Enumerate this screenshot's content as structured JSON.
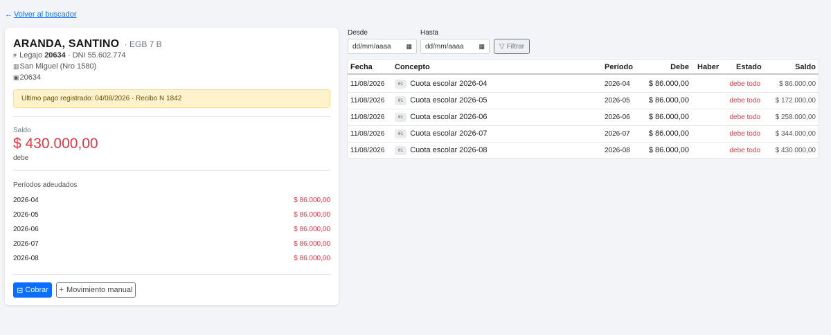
{
  "nav": {
    "back_label": "Volver al buscador"
  },
  "student": {
    "name": "ARANDA, SANTINO",
    "course": "· EGB 7 B",
    "legajo_label": "Legajo",
    "legajo": "20634",
    "dni": "· DNI 55.602.774",
    "address": "San Miguel (Nro 1580)",
    "id_code": "20634"
  },
  "alert": {
    "text": "Ultimo pago registrado: 04/08/2026 · Recibo N 1842"
  },
  "balance": {
    "label": "Saldo",
    "value": "$ 430.000,00",
    "status": "debe"
  },
  "periods": {
    "title": "Períodos adeudados",
    "items": [
      {
        "period": "2026-04",
        "amount": "$ 86.000,00"
      },
      {
        "period": "2026-05",
        "amount": "$ 86.000,00"
      },
      {
        "period": "2026-06",
        "amount": "$ 86.000,00"
      },
      {
        "period": "2026-07",
        "amount": "$ 86.000,00"
      },
      {
        "period": "2026-08",
        "amount": "$ 86.000,00"
      }
    ]
  },
  "actions": {
    "cobrar_label": "Cobrar",
    "manual_label": "Movimiento manual"
  },
  "filters": {
    "desde_label": "Desde",
    "hasta_label": "Hasta",
    "desde_placeholder": "dd/mm/aaaa",
    "hasta_placeholder": "dd/mm/aaaa",
    "filter_label": "Filtrar"
  },
  "table": {
    "headers": {
      "fecha": "Fecha",
      "concepto": "Concepto",
      "periodo": "Período",
      "debe": "Debe",
      "haber": "Haber",
      "estado": "Estado",
      "saldo": "Saldo"
    },
    "rows": [
      {
        "fecha": "11/08/2026",
        "code": "01",
        "concepto": "Cuota escolar 2026-04",
        "periodo": "2026-04",
        "debe": "$ 86.000,00",
        "haber": "",
        "estado": "debe todo",
        "saldo": "$ 86.000,00"
      },
      {
        "fecha": "11/08/2026",
        "code": "01",
        "concepto": "Cuota escolar 2026-05",
        "periodo": "2026-05",
        "debe": "$ 86.000,00",
        "haber": "",
        "estado": "debe todo",
        "saldo": "$ 172.000,00"
      },
      {
        "fecha": "11/08/2026",
        "code": "01",
        "concepto": "Cuota escolar 2026-06",
        "periodo": "2026-06",
        "debe": "$ 86.000,00",
        "haber": "",
        "estado": "debe todo",
        "saldo": "$ 258.000,00"
      },
      {
        "fecha": "11/08/2026",
        "code": "01",
        "concepto": "Cuota escolar 2026-07",
        "periodo": "2026-07",
        "debe": "$ 86.000,00",
        "haber": "",
        "estado": "debe todo",
        "saldo": "$ 344.000,00"
      },
      {
        "fecha": "11/08/2026",
        "code": "01",
        "concepto": "Cuota escolar 2026-08",
        "periodo": "2026-08",
        "debe": "$ 86.000,00",
        "haber": "",
        "estado": "debe todo",
        "saldo": "$ 430.000,00"
      }
    ]
  },
  "colors": {
    "accent": "#0d6efd",
    "danger": "#dc3545",
    "alert_bg": "#fff3cd"
  }
}
